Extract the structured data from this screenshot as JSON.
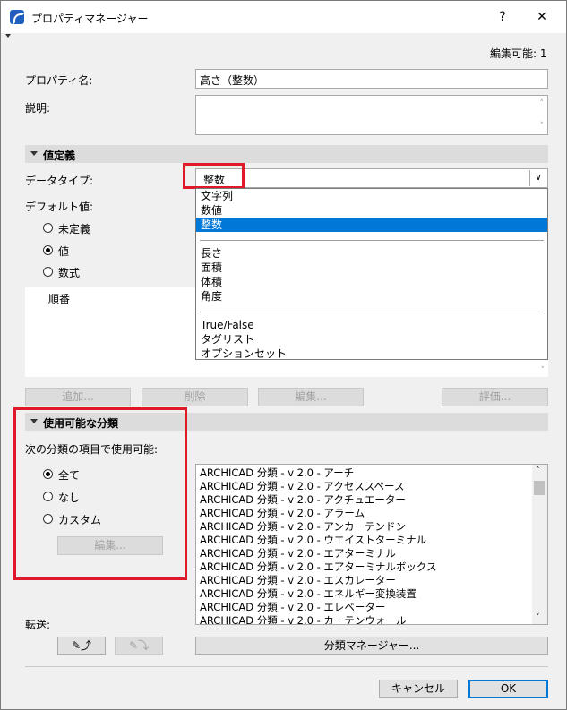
{
  "window": {
    "title": "プロパティマネージャー",
    "help_glyph": "?",
    "close_glyph": "✕",
    "editable_label": "編集可能: 1"
  },
  "fields": {
    "property_name_label": "プロパティ名:",
    "property_name_value": "高さ（整数）",
    "description_label": "説明:",
    "description_value": ""
  },
  "value_definition": {
    "section_label": "値定義",
    "data_type_label": "データタイプ:",
    "data_type_value": "整数",
    "default_value_label": "デフォルト値:",
    "radios": [
      {
        "label": "未定義",
        "checked": false
      },
      {
        "label": "値",
        "checked": true
      },
      {
        "label": "数式",
        "checked": false
      }
    ],
    "order_column_header": "順番",
    "dropdown_options": {
      "group1": [
        "文字列",
        "数値",
        "整数"
      ],
      "group2": [
        "長さ",
        "面積",
        "体積",
        "角度"
      ],
      "group3": [
        "True/False",
        "タグリスト",
        "オプションセット"
      ]
    },
    "buttons": {
      "add": "追加...",
      "delete": "削除",
      "edit": "編集...",
      "evaluate": "評価..."
    }
  },
  "classification": {
    "section_label": "使用可能な分類",
    "usable_label": "次の分類の項目で使用可能:",
    "radios": [
      {
        "label": "全て",
        "checked": true
      },
      {
        "label": "なし",
        "checked": false
      },
      {
        "label": "カスタム",
        "checked": false
      }
    ],
    "edit_button": "編集...",
    "items": [
      "ARCHICAD 分類 - v 2.0 - アーチ",
      "ARCHICAD 分類 - v 2.0 - アクセススペース",
      "ARCHICAD 分類 - v 2.0 - アクチュエーター",
      "ARCHICAD 分類 - v 2.0 - アラーム",
      "ARCHICAD 分類 - v 2.0 - アンカーテンドン",
      "ARCHICAD 分類 - v 2.0 - ウエイストターミナル",
      "ARCHICAD 分類 - v 2.0 - エアターミナル",
      "ARCHICAD 分類 - v 2.0 - エアターミナルボックス",
      "ARCHICAD 分類 - v 2.0 - エスカレーター",
      "ARCHICAD 分類 - v 2.0 - エネルギー変換装置",
      "ARCHICAD 分類 - v 2.0 - エレベーター",
      "ARCHICAD 分類 - v 2.0 - カーテンウォール"
    ],
    "manager_button": "分類マネージャー..."
  },
  "transfer": {
    "label": "転送:"
  },
  "footer": {
    "cancel": "キャンセル",
    "ok": "OK"
  },
  "colors": {
    "highlight": "#e0192a",
    "selection": "#0078d7"
  }
}
